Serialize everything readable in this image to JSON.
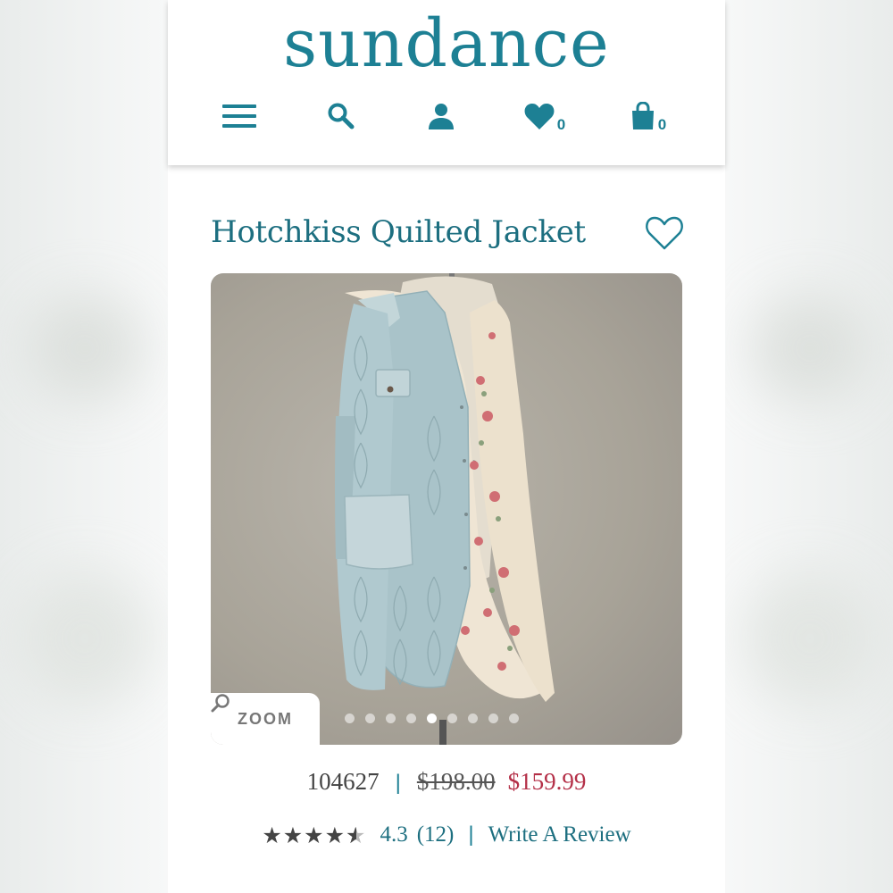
{
  "header": {
    "logo": "sundance",
    "nav": {
      "menu_icon": "hamburger-menu-icon",
      "search_icon": "search-icon",
      "account_icon": "account-icon",
      "wishlist_icon": "heart-icon",
      "wishlist_count": "0",
      "cart_icon": "shopping-bag-icon",
      "cart_count": "0"
    }
  },
  "product": {
    "title": "Hotchkiss Quilted Jacket",
    "favorite_icon": "heart-outline-icon",
    "image": {
      "zoom_label": "ZOOM",
      "zoom_icon": "magnifier-icon",
      "dot_count": 9,
      "active_dot": 5
    },
    "sku": "104627",
    "original_price": "$198.00",
    "sale_price": "$159.99",
    "rating": 4.3,
    "rating_text": "4.3",
    "review_count": "(12)",
    "write_review": "Write A Review"
  },
  "colors": {
    "brand": "#1d8094",
    "sale": "#b43048",
    "text": "#444444"
  }
}
